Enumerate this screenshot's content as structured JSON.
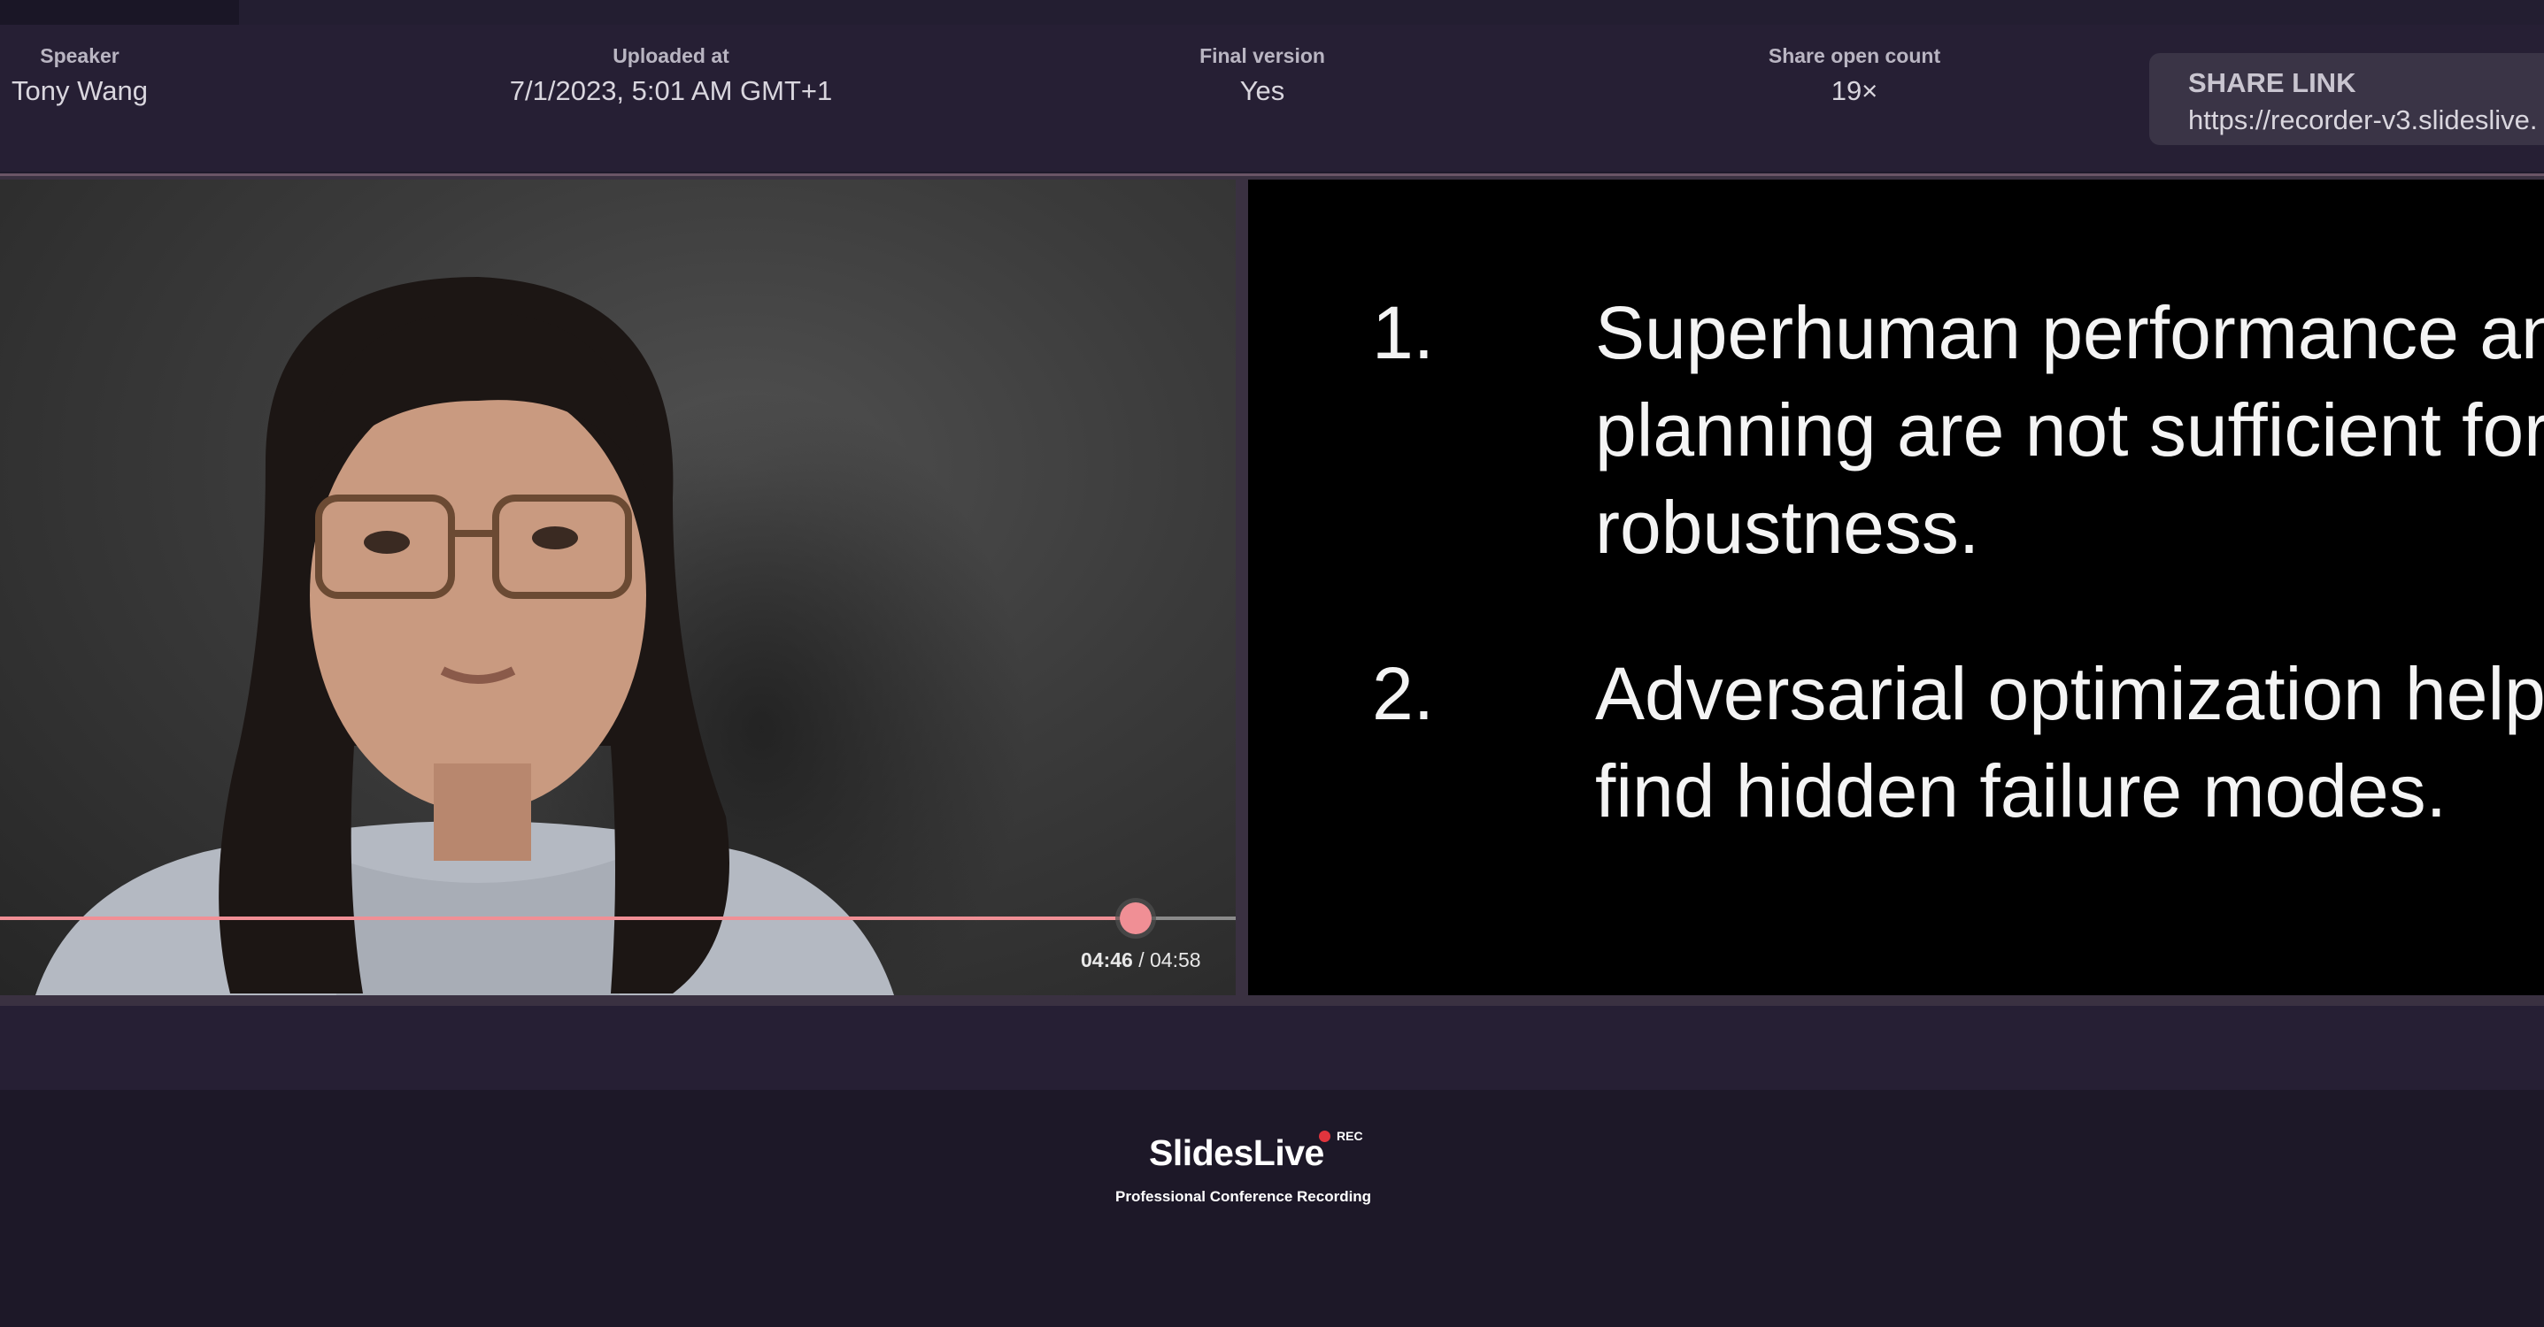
{
  "metadata": {
    "speaker_label": "Speaker",
    "speaker_value": "Tony Wang",
    "uploaded_label": "Uploaded at",
    "uploaded_value": "7/1/2023, 5:01 AM GMT+1",
    "final_label": "Final version",
    "final_value": "Yes",
    "share_count_label": "Share open count",
    "share_count_value": "19×"
  },
  "share_link": {
    "label": "SHARE LINK",
    "url": "https://recorder-v3.slideslive."
  },
  "player": {
    "current_time": "04:46",
    "separator": "/",
    "duration": "04:58",
    "progress": 0.96
  },
  "slide": {
    "items": [
      {
        "number": "1.",
        "lines": [
          "Superhuman performance and",
          "planning are not sufficient for",
          "robustness."
        ]
      },
      {
        "number": "2.",
        "lines": [
          "Adversarial optimization helps",
          "find hidden failure modes."
        ]
      }
    ]
  },
  "footer": {
    "logo": "SlidesLive",
    "rec_badge": "REC",
    "tagline": "Professional Conference Recording"
  },
  "colors": {
    "accent": "#f08f95",
    "rec": "#e0343d",
    "background": "#1e1a2b"
  }
}
